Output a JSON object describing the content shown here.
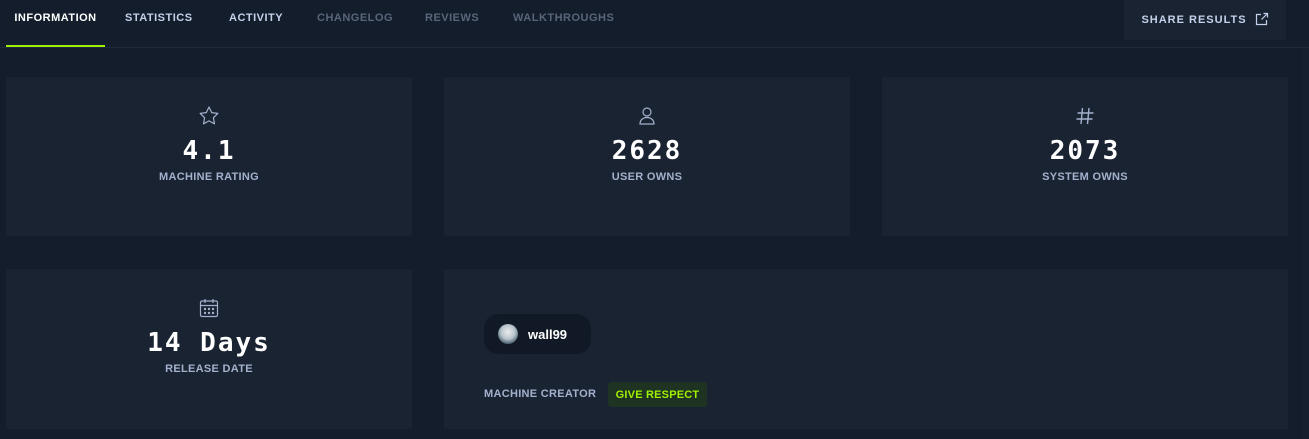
{
  "tabs": [
    {
      "label": "INFORMATION",
      "state": "active"
    },
    {
      "label": "STATISTICS",
      "state": "normal"
    },
    {
      "label": "ACTIVITY",
      "state": "normal"
    },
    {
      "label": "CHANGELOG",
      "state": "muted"
    },
    {
      "label": "REVIEWS",
      "state": "muted"
    },
    {
      "label": "WALKTHROUGHS",
      "state": "muted"
    }
  ],
  "share": {
    "label": "SHARE RESULTS",
    "icon": "external-link-icon"
  },
  "stats": {
    "rating": {
      "value": "4.1",
      "label": "MACHINE RATING",
      "icon": "star-icon"
    },
    "user_owns": {
      "value": "2628",
      "label": "USER OWNS",
      "icon": "user-icon"
    },
    "system_owns": {
      "value": "2073",
      "label": "SYSTEM OWNS",
      "icon": "hash-icon"
    },
    "release": {
      "value": "14 Days",
      "label": "RELEASE DATE",
      "icon": "calendar-icon"
    }
  },
  "creator": {
    "name": "wall99",
    "label": "MACHINE CREATOR",
    "respect_label": "GIVE RESPECT"
  },
  "colors": {
    "background": "#141d2b",
    "card": "#1a2332",
    "accent": "#9fef00",
    "text": "#a4b1cd"
  }
}
